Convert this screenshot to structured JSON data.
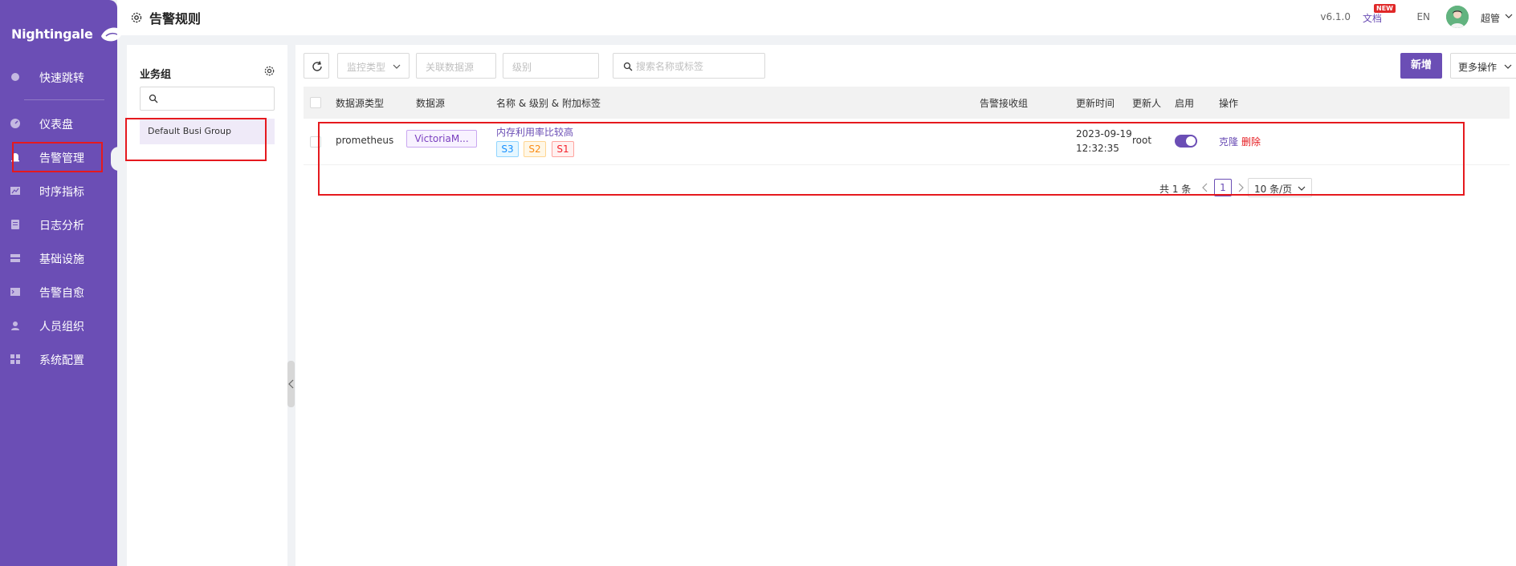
{
  "brand": {
    "name": "Nightingale"
  },
  "sidebar": {
    "items": [
      {
        "key": "quick-jump",
        "label": "快速跳转"
      },
      {
        "key": "dashboard",
        "label": "仪表盘"
      },
      {
        "key": "alerting",
        "label": "告警管理",
        "active": true
      },
      {
        "key": "metrics",
        "label": "时序指标"
      },
      {
        "key": "logs",
        "label": "日志分析"
      },
      {
        "key": "infra",
        "label": "基础设施"
      },
      {
        "key": "self-heal",
        "label": "告警自愈"
      },
      {
        "key": "users",
        "label": "人员组织"
      },
      {
        "key": "settings",
        "label": "系统配置"
      }
    ]
  },
  "header": {
    "title": "告警规则",
    "version": "v6.1.0",
    "docs": "文档",
    "new_badge": "NEW",
    "lang": "EN",
    "user": "超管"
  },
  "business_group": {
    "title": "业务组",
    "search_placeholder": "",
    "items": [
      "Default Busi Group"
    ]
  },
  "toolbar": {
    "monitor_type_placeholder": "监控类型",
    "datasource_placeholder": "关联数据源",
    "level_placeholder": "级别",
    "search_placeholder": "搜索名称或标签",
    "new_label": "新增",
    "more_label": "更多操作"
  },
  "table": {
    "columns": [
      "数据源类型",
      "数据源",
      "名称 & 级别 & 附加标签",
      "告警接收组",
      "更新时间",
      "更新人",
      "启用",
      "操作"
    ],
    "rows": [
      {
        "ds_type": "prometheus",
        "datasource": "VictoriaM...",
        "name": "内存利用率比较高",
        "severities": [
          "S3",
          "S2",
          "S1"
        ],
        "notify_groups": "",
        "update_date": "2023-09-19",
        "update_clock": "12:32:35",
        "updater": "root",
        "enabled": true,
        "actions": {
          "clone": "克隆",
          "delete": "删除"
        }
      }
    ]
  },
  "pagination": {
    "total": "共 1 条",
    "current": "1",
    "page_size": "10 条/页"
  },
  "colors": {
    "primary": "#6b4eb5",
    "danger": "#e5191e",
    "annotation": "#e5191e"
  }
}
